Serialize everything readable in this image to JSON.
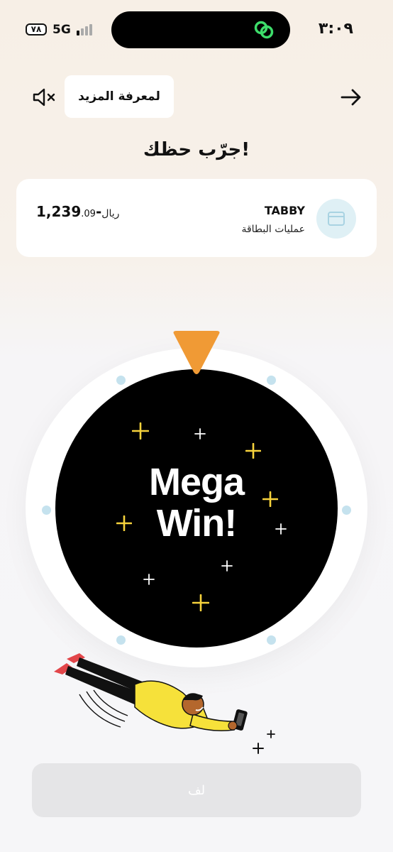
{
  "status_bar": {
    "battery": "٧٨",
    "network": "5G",
    "time": "٣:٠٩"
  },
  "header": {
    "learn_more_label": "لمعرفة المزيد",
    "mute_icon": "speaker-mute-icon",
    "back_icon": "arrow-right-icon"
  },
  "page": {
    "title": "جرّب حظك!"
  },
  "transaction": {
    "merchant": "TABBY",
    "category": "عمليات البطاقة",
    "amount_main": "-1,239",
    "amount_decimal": ".09",
    "currency": "ريال",
    "icon": "card-icon"
  },
  "wheel": {
    "result_line1": "Mega",
    "result_line2": "Win!",
    "pointer_color": "#f09a35",
    "sparkle_colors": [
      "#f6d23c",
      "#ffffff"
    ]
  },
  "spin_button": {
    "label": "لف"
  },
  "colors": {
    "accent_orange": "#f09a35",
    "figure_yellow": "#f6e13a",
    "dot_blue": "#c5e2ee"
  }
}
